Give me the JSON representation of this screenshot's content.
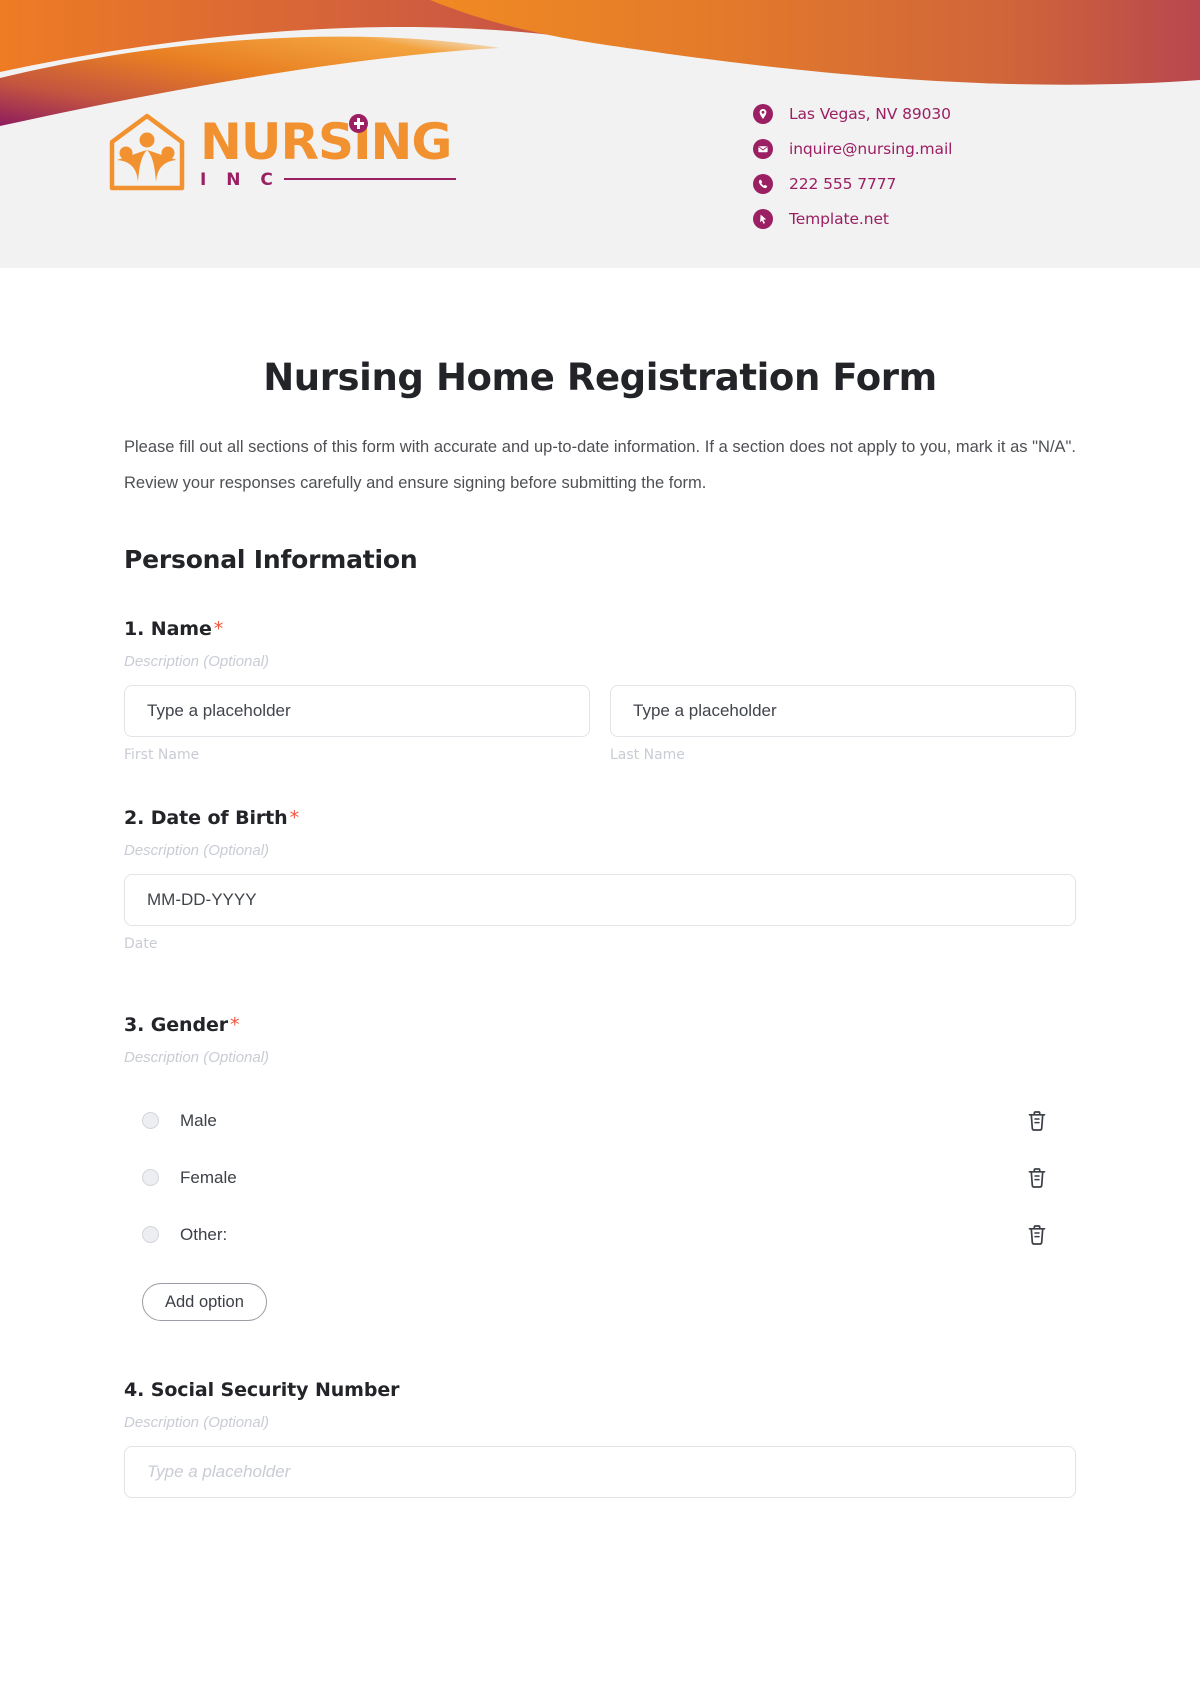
{
  "brand": {
    "logo_word": "NURSING",
    "logo_sub": "I N C",
    "logo_mark_icon": "house-with-people-icon",
    "accent_orange": "#F2912F",
    "accent_purple": "#9B2063"
  },
  "header": {
    "contacts": [
      {
        "icon": "location-pin-icon",
        "text": "Las Vegas, NV 89030"
      },
      {
        "icon": "envelope-icon",
        "text": "inquire@nursing.mail"
      },
      {
        "icon": "phone-icon",
        "text": "222 555 7777"
      },
      {
        "icon": "cursor-arrow-icon",
        "text": "Template.net"
      }
    ]
  },
  "form": {
    "title": "Nursing Home Registration Form",
    "intro": "Please fill out all sections of this form with accurate and up-to-date information. If a section does not apply to you, mark it as \"N/A\". Review your responses carefully and ensure signing before submitting the form.",
    "section_heading": "Personal Information",
    "description_placeholder": "Description (Optional)",
    "required_marker": "*",
    "questions": [
      {
        "number": "1.",
        "label": "Name",
        "required": true,
        "description": "Description (Optional)",
        "fields": [
          {
            "placeholder": "Type a placeholder",
            "sub_label": "First Name"
          },
          {
            "placeholder": "Type a placeholder",
            "sub_label": "Last Name"
          }
        ]
      },
      {
        "number": "2.",
        "label": "Date of Birth",
        "required": true,
        "description": "Description (Optional)",
        "fields": [
          {
            "placeholder": "MM-DD-YYYY",
            "sub_label": "Date"
          }
        ]
      },
      {
        "number": "3.",
        "label": "Gender",
        "required": true,
        "description": "Description (Optional)",
        "options": [
          {
            "text": "Male",
            "delete_icon": "trash-icon"
          },
          {
            "text": "Female",
            "delete_icon": "trash-icon"
          },
          {
            "text": "Other:",
            "delete_icon": "trash-icon"
          }
        ],
        "add_option_label": "Add option"
      },
      {
        "number": "4.",
        "label": "Social Security Number",
        "required": false,
        "description": "Description (Optional)",
        "fields": [
          {
            "placeholder": "Type a placeholder",
            "sub_label": ""
          }
        ]
      }
    ]
  }
}
